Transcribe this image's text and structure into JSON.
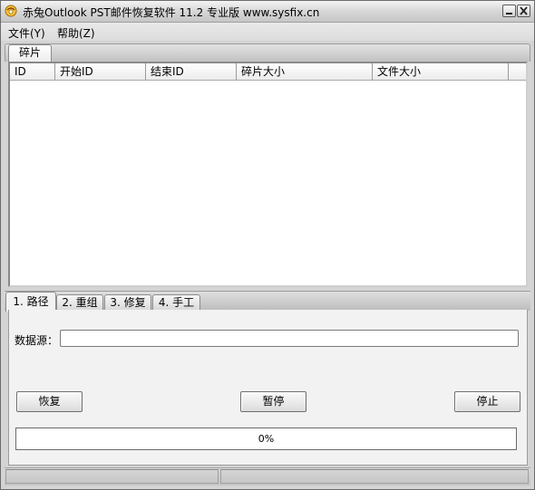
{
  "window": {
    "title": "赤兔Outlook PST邮件恢复软件 11.2 专业版 www.sysfix.cn",
    "icon": "app-logo-icon",
    "controls": [
      "minimize-icon",
      "close-icon"
    ]
  },
  "menu": {
    "file": "文件(Y)",
    "help": "帮助(Z)"
  },
  "fragment_tab": {
    "label": "碎片"
  },
  "list": {
    "columns": [
      "ID",
      "开始ID",
      "结束ID",
      "碎片大小",
      "文件大小"
    ],
    "rows": []
  },
  "tabs": [
    {
      "label": "1. 路径",
      "active": true
    },
    {
      "label": "2. 重组",
      "active": false
    },
    {
      "label": "3. 修复",
      "active": false
    },
    {
      "label": "4. 手工",
      "active": false
    }
  ],
  "path_panel": {
    "source_label": "数据源：",
    "source_value": "",
    "recover_label": "恢复",
    "pause_label": "暂停",
    "stop_label": "停止"
  },
  "progress": {
    "value": 0,
    "text": "0%"
  },
  "status": {
    "left": "",
    "right": ""
  },
  "colors": {
    "window_bg": "#d4d4d4",
    "panel_bg": "#f2f2f2",
    "progress_fill": "#3a7bd5"
  }
}
